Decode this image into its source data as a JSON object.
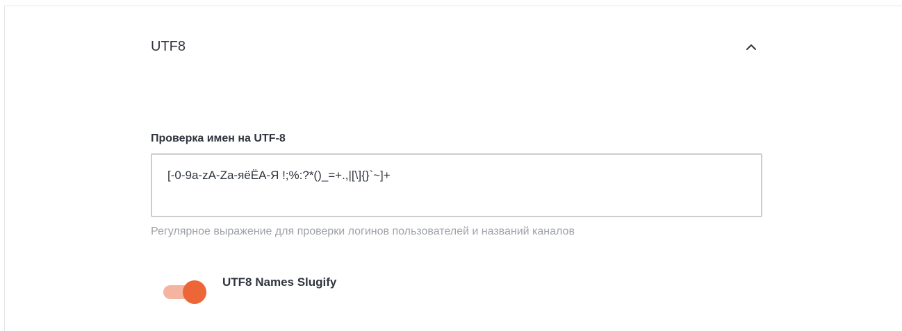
{
  "section": {
    "title": "UTF8",
    "collapse_icon": "chevron-up-icon"
  },
  "field": {
    "label": "Проверка имен на UTF-8",
    "value": "[-0-9a-zA-Za-яёЁА-Я !;%:?*()_=+.,|[\\]{}`~]+",
    "hint": "Регулярное выражение для проверки логинов пользователей и названий каналов"
  },
  "toggle": {
    "label": "UTF8 Names Slugify",
    "checked": true,
    "accent_color": "#ec6638",
    "track_color": "#f5b49f"
  }
}
